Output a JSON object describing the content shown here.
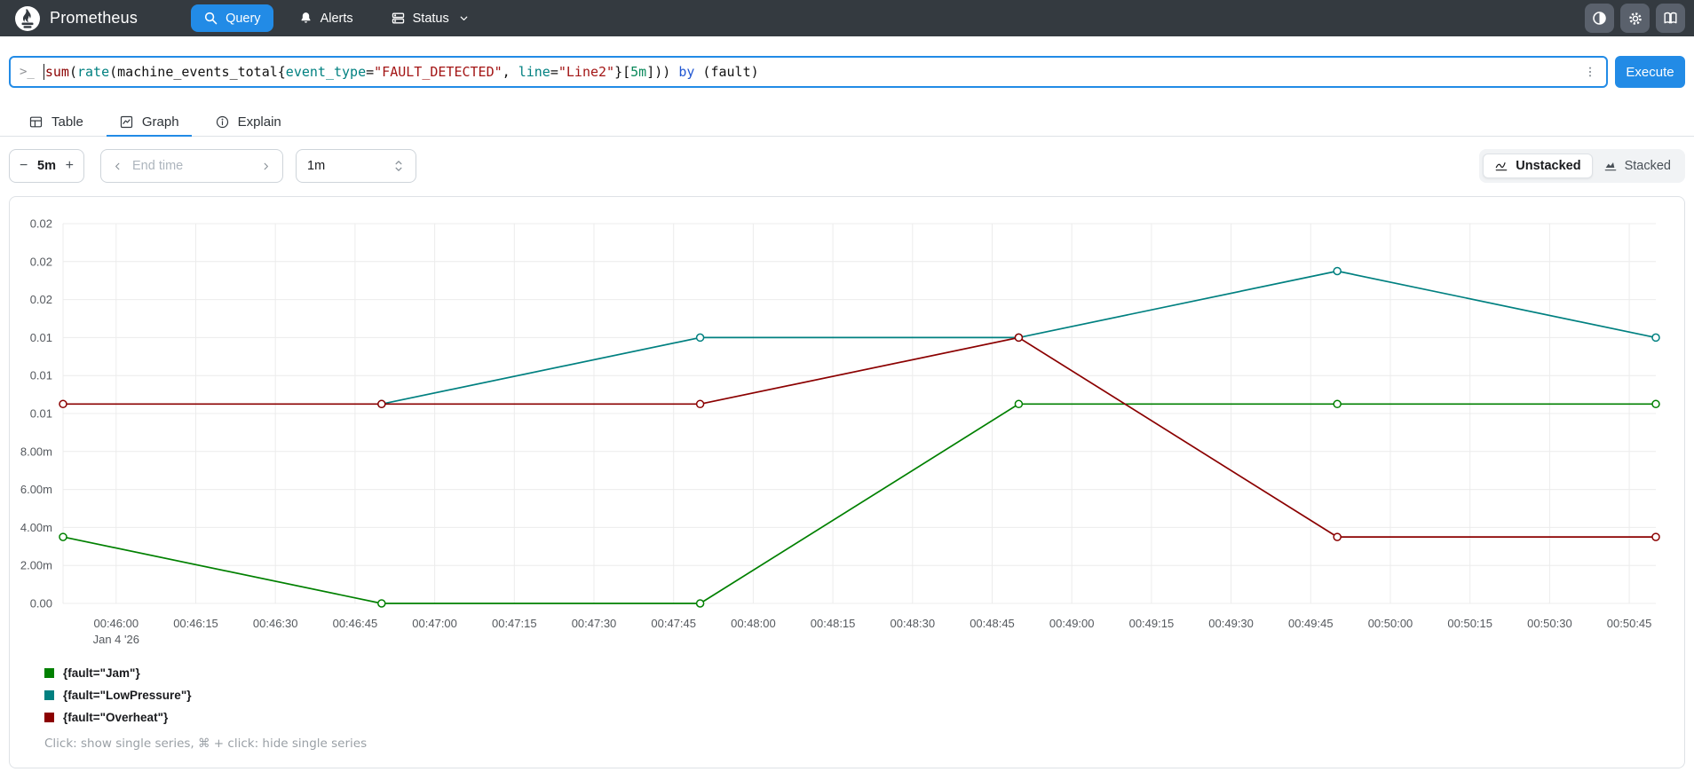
{
  "navbar": {
    "brand": "Prometheus",
    "items": [
      {
        "label": "Query",
        "icon": "search-icon",
        "active": true
      },
      {
        "label": "Alerts",
        "icon": "bell-icon",
        "active": false
      },
      {
        "label": "Status",
        "icon": "server-icon",
        "active": false,
        "has_dropdown": true
      }
    ],
    "right_icons": [
      "theme-toggle-icon",
      "settings-gear-icon",
      "docs-book-icon"
    ]
  },
  "query_bar": {
    "prompt": ">_",
    "query": "sum(rate(machine_events_total{event_type=\"FAULT_DETECTED\", line=\"Line2\"}[5m])) by (fault)",
    "tokens": [
      {
        "text": "sum",
        "type": "aggregate"
      },
      {
        "text": "(",
        "type": "plain"
      },
      {
        "text": "rate",
        "type": "function"
      },
      {
        "text": "(",
        "type": "plain"
      },
      {
        "text": "machine_events_total",
        "type": "metric"
      },
      {
        "text": "{",
        "type": "plain"
      },
      {
        "text": "event_type",
        "type": "label"
      },
      {
        "text": "=",
        "type": "plain"
      },
      {
        "text": "\"FAULT_DETECTED\"",
        "type": "string"
      },
      {
        "text": ", ",
        "type": "plain"
      },
      {
        "text": "line",
        "type": "label"
      },
      {
        "text": "=",
        "type": "plain"
      },
      {
        "text": "\"Line2\"",
        "type": "string"
      },
      {
        "text": "}[",
        "type": "plain"
      },
      {
        "text": "5m",
        "type": "duration"
      },
      {
        "text": "])) ",
        "type": "plain"
      },
      {
        "text": "by",
        "type": "keyword"
      },
      {
        "text": " (fault)",
        "type": "plain"
      }
    ],
    "execute_label": "Execute"
  },
  "tabs": [
    {
      "label": "Table",
      "icon": "table-icon",
      "active": false
    },
    {
      "label": "Graph",
      "icon": "graph-icon",
      "active": true
    },
    {
      "label": "Explain",
      "icon": "info-icon",
      "active": false
    }
  ],
  "controls": {
    "duration": {
      "minus": "−",
      "value": "5m",
      "plus": "+"
    },
    "end_time_placeholder": "End time",
    "resolution_value": "1m",
    "stacking": [
      {
        "label": "Unstacked",
        "icon": "line-chart-icon",
        "active": true
      },
      {
        "label": "Stacked",
        "icon": "area-chart-icon",
        "active": false
      }
    ]
  },
  "chart_data": {
    "type": "line",
    "title": "",
    "xlabel": "",
    "ylabel": "",
    "grid": true,
    "legend_position": "bottom-left",
    "x_domain_seconds": [
      0,
      300
    ],
    "x_domain_note": "0s = 00:45:50, 300s = 00:50:50, Jan 4 '26",
    "ylim": [
      0,
      0.02
    ],
    "yticks": [
      {
        "v": 0.02,
        "label": "0.02"
      },
      {
        "v": 0.018,
        "label": "0.02"
      },
      {
        "v": 0.016,
        "label": "0.02"
      },
      {
        "v": 0.014,
        "label": "0.01"
      },
      {
        "v": 0.012,
        "label": "0.01"
      },
      {
        "v": 0.01,
        "label": "0.01"
      },
      {
        "v": 0.008,
        "label": "8.00m"
      },
      {
        "v": 0.006,
        "label": "6.00m"
      },
      {
        "v": 0.004,
        "label": "4.00m"
      },
      {
        "v": 0.002,
        "label": "2.00m"
      },
      {
        "v": 0.0,
        "label": "0.00"
      }
    ],
    "xticks": [
      {
        "t": 10,
        "label": "00:46:00",
        "sublabel": "Jan 4 '26"
      },
      {
        "t": 25,
        "label": "00:46:15"
      },
      {
        "t": 40,
        "label": "00:46:30"
      },
      {
        "t": 55,
        "label": "00:46:45"
      },
      {
        "t": 70,
        "label": "00:47:00"
      },
      {
        "t": 85,
        "label": "00:47:15"
      },
      {
        "t": 100,
        "label": "00:47:30"
      },
      {
        "t": 115,
        "label": "00:47:45"
      },
      {
        "t": 130,
        "label": "00:48:00"
      },
      {
        "t": 145,
        "label": "00:48:15"
      },
      {
        "t": 160,
        "label": "00:48:30"
      },
      {
        "t": 175,
        "label": "00:48:45"
      },
      {
        "t": 190,
        "label": "00:49:00"
      },
      {
        "t": 205,
        "label": "00:49:15"
      },
      {
        "t": 220,
        "label": "00:49:30"
      },
      {
        "t": 235,
        "label": "00:49:45"
      },
      {
        "t": 250,
        "label": "00:50:00"
      },
      {
        "t": 265,
        "label": "00:50:15"
      },
      {
        "t": 280,
        "label": "00:50:30"
      },
      {
        "t": 295,
        "label": "00:50:45"
      }
    ],
    "series": [
      {
        "name": "{fault=\"Jam\"}",
        "color": "#008000",
        "x": [
          0,
          60,
          120,
          180,
          240,
          300
        ],
        "values": [
          0.0035,
          0.0,
          0.0,
          0.0105,
          0.0105,
          0.0105
        ]
      },
      {
        "name": "{fault=\"LowPressure\"}",
        "color": "#008080",
        "x": [
          60,
          120,
          180,
          240,
          300
        ],
        "values": [
          0.0105,
          0.014,
          0.014,
          0.0175,
          0.014
        ]
      },
      {
        "name": "{fault=\"Overheat\"}",
        "color": "#8b0000",
        "x": [
          0,
          60,
          120,
          180,
          240,
          300
        ],
        "values": [
          0.0105,
          0.0105,
          0.0105,
          0.014,
          0.0035,
          0.0035
        ]
      }
    ],
    "footer_hint": "Click: show single series, ⌘ + click: hide single series"
  },
  "colors": {
    "accent_blue": "#228be6",
    "navbar_bg": "#343a40",
    "grid_line": "#ececec",
    "axis_text": "#55595e"
  }
}
